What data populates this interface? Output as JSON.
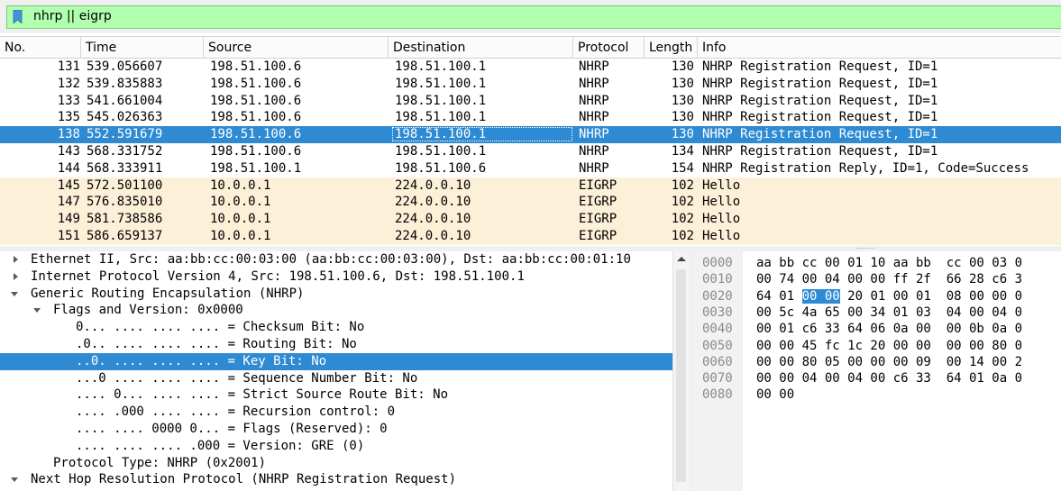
{
  "filter": {
    "value": "nhrp || eigrp",
    "bookmark_icon": "bookmark-icon"
  },
  "packet_list": {
    "columns": [
      "No.",
      "Time",
      "Source",
      "Destination",
      "Protocol",
      "Length",
      "Info"
    ],
    "rows": [
      {
        "no": "131",
        "time": "539.056607",
        "source": "198.51.100.6",
        "destination": "198.51.100.1",
        "protocol": "NHRP",
        "length": "130",
        "info": "NHRP Registration Request, ID=1",
        "selected": false
      },
      {
        "no": "132",
        "time": "539.835883",
        "source": "198.51.100.6",
        "destination": "198.51.100.1",
        "protocol": "NHRP",
        "length": "130",
        "info": "NHRP Registration Request, ID=1",
        "selected": false
      },
      {
        "no": "133",
        "time": "541.661004",
        "source": "198.51.100.6",
        "destination": "198.51.100.1",
        "protocol": "NHRP",
        "length": "130",
        "info": "NHRP Registration Request, ID=1",
        "selected": false
      },
      {
        "no": "135",
        "time": "545.026363",
        "source": "198.51.100.6",
        "destination": "198.51.100.1",
        "protocol": "NHRP",
        "length": "130",
        "info": "NHRP Registration Request, ID=1",
        "selected": false
      },
      {
        "no": "138",
        "time": "552.591679",
        "source": "198.51.100.6",
        "destination": "198.51.100.1",
        "protocol": "NHRP",
        "length": "130",
        "info": "NHRP Registration Request, ID=1",
        "selected": true
      },
      {
        "no": "143",
        "time": "568.331752",
        "source": "198.51.100.6",
        "destination": "198.51.100.1",
        "protocol": "NHRP",
        "length": "134",
        "info": "NHRP Registration Request, ID=1",
        "selected": false
      },
      {
        "no": "144",
        "time": "568.333911",
        "source": "198.51.100.1",
        "destination": "198.51.100.6",
        "protocol": "NHRP",
        "length": "154",
        "info": "NHRP Registration Reply, ID=1, Code=Success",
        "selected": false
      },
      {
        "no": "145",
        "time": "572.501100",
        "source": "10.0.0.1",
        "destination": "224.0.0.10",
        "protocol": "EIGRP",
        "length": "102",
        "info": "Hello",
        "selected": false
      },
      {
        "no": "147",
        "time": "576.835010",
        "source": "10.0.0.1",
        "destination": "224.0.0.10",
        "protocol": "EIGRP",
        "length": "102",
        "info": "Hello",
        "selected": false
      },
      {
        "no": "149",
        "time": "581.738586",
        "source": "10.0.0.1",
        "destination": "224.0.0.10",
        "protocol": "EIGRP",
        "length": "102",
        "info": "Hello",
        "selected": false
      },
      {
        "no": "151",
        "time": "586.659137",
        "source": "10.0.0.1",
        "destination": "224.0.0.10",
        "protocol": "EIGRP",
        "length": "102",
        "info": "Hello",
        "selected": false
      }
    ]
  },
  "details": {
    "rows": [
      {
        "depth": 0,
        "expander": "collapsed",
        "text": "Ethernet II, Src: aa:bb:cc:00:03:00 (aa:bb:cc:00:03:00), Dst: aa:bb:cc:00:01:10",
        "selected": false
      },
      {
        "depth": 0,
        "expander": "collapsed",
        "text": "Internet Protocol Version 4, Src: 198.51.100.6, Dst: 198.51.100.1",
        "selected": false
      },
      {
        "depth": 0,
        "expander": "expanded",
        "text": "Generic Routing Encapsulation (NHRP)",
        "selected": false
      },
      {
        "depth": 1,
        "expander": "expanded",
        "text": "Flags and Version: 0x0000",
        "selected": false
      },
      {
        "depth": 2,
        "expander": "none",
        "text": "0... .... .... .... = Checksum Bit: No",
        "selected": false
      },
      {
        "depth": 2,
        "expander": "none",
        "text": ".0.. .... .... .... = Routing Bit: No",
        "selected": false
      },
      {
        "depth": 2,
        "expander": "none",
        "text": "..0. .... .... .... = Key Bit: No",
        "selected": true
      },
      {
        "depth": 2,
        "expander": "none",
        "text": "...0 .... .... .... = Sequence Number Bit: No",
        "selected": false
      },
      {
        "depth": 2,
        "expander": "none",
        "text": ".... 0... .... .... = Strict Source Route Bit: No",
        "selected": false
      },
      {
        "depth": 2,
        "expander": "none",
        "text": ".... .000 .... .... = Recursion control: 0",
        "selected": false
      },
      {
        "depth": 2,
        "expander": "none",
        "text": ".... .... 0000 0... = Flags (Reserved): 0",
        "selected": false
      },
      {
        "depth": 2,
        "expander": "none",
        "text": ".... .... .... .000 = Version: GRE (0)",
        "selected": false
      },
      {
        "depth": 1,
        "expander": "none",
        "text": "Protocol Type: NHRP (0x2001)",
        "selected": false
      },
      {
        "depth": 0,
        "expander": "expanded",
        "text": "Next Hop Resolution Protocol (NHRP Registration Request)",
        "selected": false
      }
    ]
  },
  "bytes": {
    "rows": [
      {
        "offset": "0000",
        "pre": "aa bb cc 00 01 10 aa bb  cc 00 03 0",
        "hl": "",
        "post": ""
      },
      {
        "offset": "0010",
        "pre": "00 74 00 04 00 00 ff 2f  66 28 c6 3",
        "hl": "",
        "post": ""
      },
      {
        "offset": "0020",
        "pre": "64 01 ",
        "hl": "00 00",
        "post": " 20 01 00 01  08 00 00 0"
      },
      {
        "offset": "0030",
        "pre": "00 5c 4a 65 00 34 01 03  04 00 04 0",
        "hl": "",
        "post": ""
      },
      {
        "offset": "0040",
        "pre": "00 01 c6 33 64 06 0a 00  00 0b 0a 0",
        "hl": "",
        "post": ""
      },
      {
        "offset": "0050",
        "pre": "00 00 45 fc 1c 20 00 00  00 00 80 0",
        "hl": "",
        "post": ""
      },
      {
        "offset": "0060",
        "pre": "00 00 80 05 00 00 00 09  00 14 00 2",
        "hl": "",
        "post": ""
      },
      {
        "offset": "0070",
        "pre": "00 00 04 00 04 00 c6 33  64 01 0a 0",
        "hl": "",
        "post": ""
      },
      {
        "offset": "0080",
        "pre": "00 00",
        "hl": "",
        "post": ""
      }
    ]
  },
  "colors": {
    "selection": "#2e8ad2",
    "filter_valid": "#afffaf",
    "eigrp_row": "#fdf0d8"
  }
}
